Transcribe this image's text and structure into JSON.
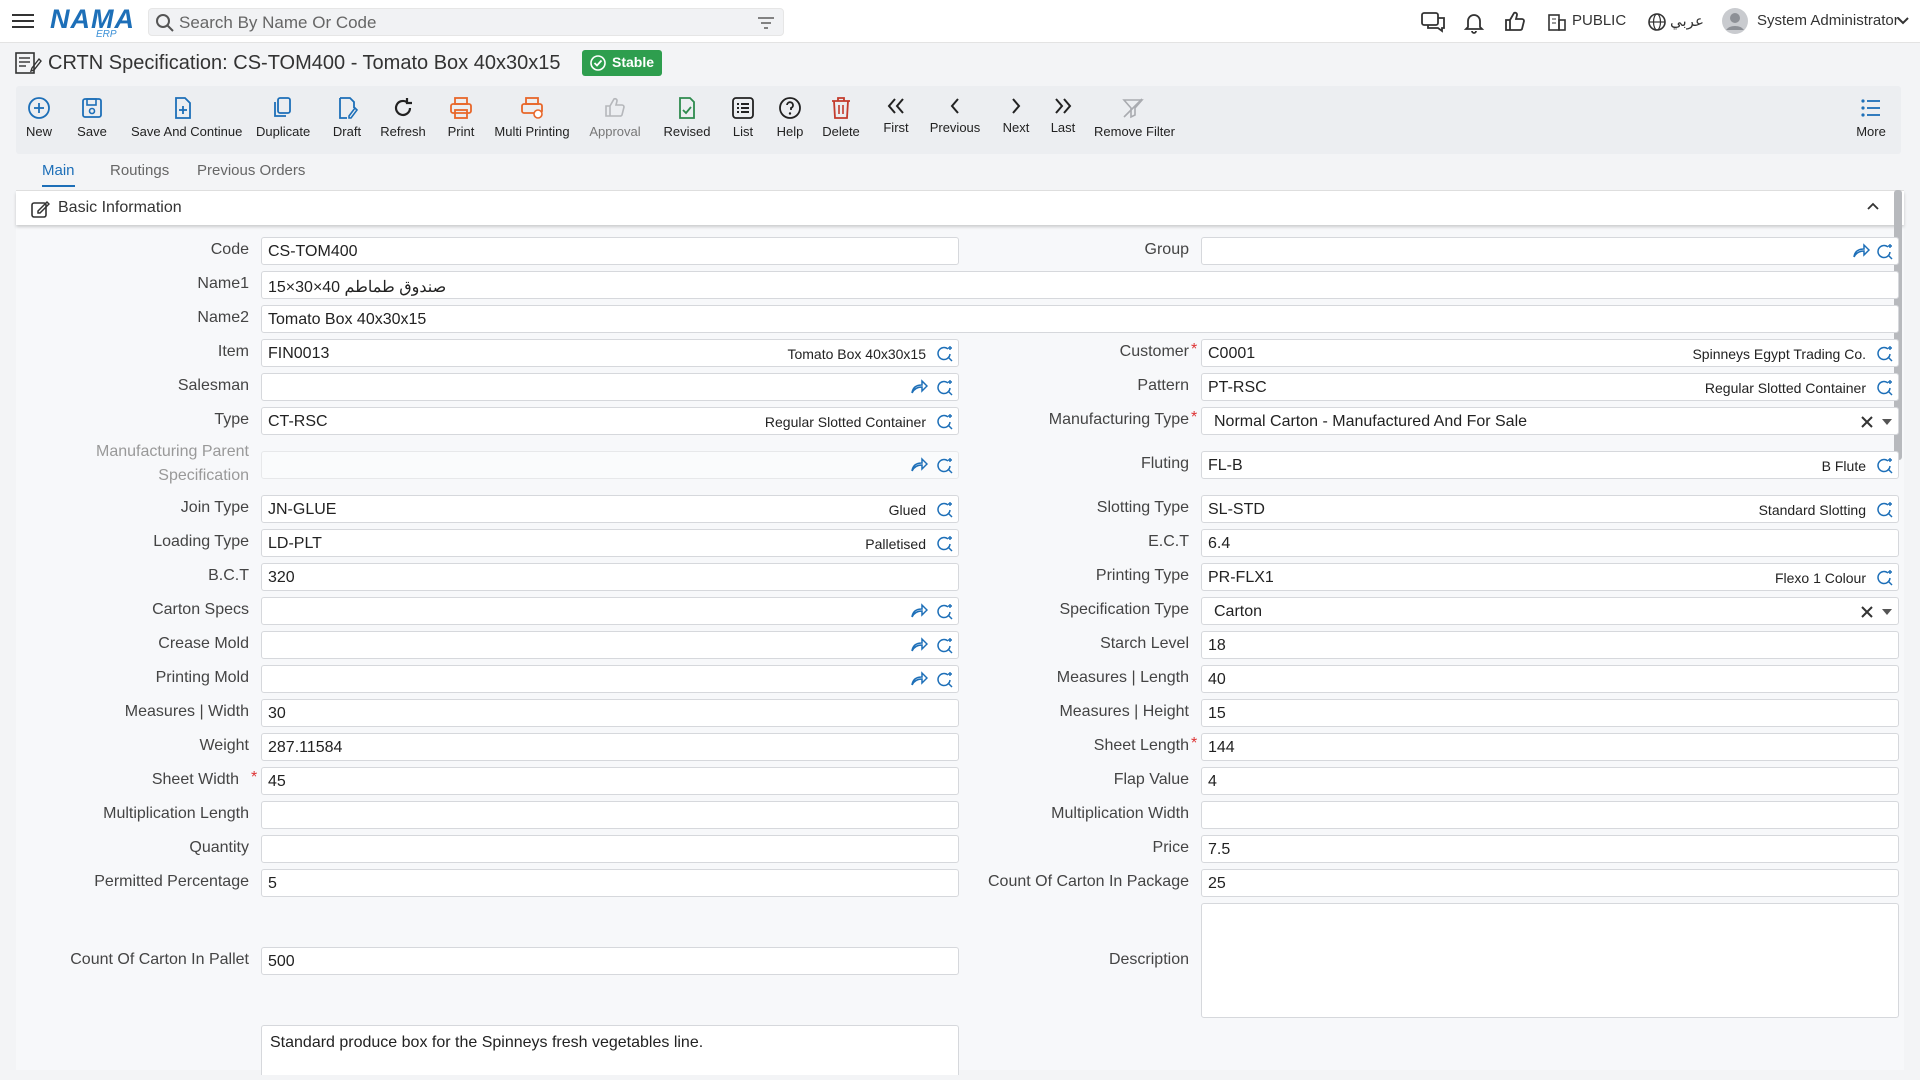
{
  "topbar": {
    "logo": "NAMA",
    "logo_sub": "ERP",
    "search_placeholder": "Search By Name Or Code",
    "company": "PUBLIC",
    "language": "عربي",
    "user": "System Administrator"
  },
  "page": {
    "title": "CRTN Specification: CS-TOM400 - Tomato Box 40x30x15",
    "status": "Stable",
    "status_color": "#2e9e4e"
  },
  "toolbar": {
    "new": "New",
    "save": "Save",
    "save_continue": "Save And Continue",
    "duplicate": "Duplicate",
    "draft": "Draft",
    "refresh": "Refresh",
    "print": "Print",
    "multi_printing": "Multi Printing",
    "approval": "Approval",
    "revised": "Revised",
    "list": "List",
    "help": "Help",
    "delete": "Delete",
    "first": "First",
    "previous": "Previous",
    "next": "Next",
    "last": "Last",
    "remove_filter": "Remove Filter",
    "more": "More"
  },
  "tabs": [
    "Main",
    "Routings",
    "Previous Orders"
  ],
  "section": {
    "title": "Basic Information"
  },
  "form": {
    "code": {
      "label": "Code",
      "value": "CS-TOM400"
    },
    "group": {
      "label": "Group",
      "value": ""
    },
    "name1": {
      "label": "Name1",
      "value": "صندوق طماطم 40×30×15"
    },
    "name2": {
      "label": "Name2",
      "value": "Tomato Box 40x30x15"
    },
    "item": {
      "label": "Item",
      "value": "FIN0013",
      "desc": "Tomato Box 40x30x15"
    },
    "customer": {
      "label": "Customer",
      "value": "C0001",
      "desc": "Spinneys Egypt Trading Co."
    },
    "salesman": {
      "label": "Salesman",
      "value": ""
    },
    "pattern": {
      "label": "Pattern",
      "value": "PT-RSC",
      "desc": "Regular Slotted Container"
    },
    "type": {
      "label": "Type",
      "value": "CT-RSC",
      "desc": "Regular Slotted Container"
    },
    "manufacturing_type": {
      "label": "Manufacturing Type",
      "value": "Normal Carton - Manufactured And For Sale"
    },
    "mfg_parent_spec": {
      "label": "Manufacturing Parent Specification",
      "value": ""
    },
    "fluting": {
      "label": "Fluting",
      "value": "FL-B",
      "desc": "B Flute"
    },
    "join_type": {
      "label": "Join Type",
      "value": "JN-GLUE",
      "desc": "Glued"
    },
    "slotting_type": {
      "label": "Slotting Type",
      "value": "SL-STD",
      "desc": "Standard Slotting"
    },
    "loading_type": {
      "label": "Loading Type",
      "value": "LD-PLT",
      "desc": "Palletised"
    },
    "ect": {
      "label": "E.C.T",
      "value": "6.4"
    },
    "bct": {
      "label": "B.C.T",
      "value": "320"
    },
    "printing_type": {
      "label": "Printing Type",
      "value": "PR-FLX1",
      "desc": "Flexo 1 Colour"
    },
    "carton_specs": {
      "label": "Carton Specs",
      "value": ""
    },
    "specification_type": {
      "label": "Specification Type",
      "value": "Carton"
    },
    "crease_mold": {
      "label": "Crease Mold",
      "value": ""
    },
    "starch_level": {
      "label": "Starch Level",
      "value": "18"
    },
    "printing_mold": {
      "label": "Printing Mold",
      "value": ""
    },
    "measures_length": {
      "label": "Measures | Length",
      "value": "40"
    },
    "measures_width": {
      "label": "Measures | Width",
      "value": "30"
    },
    "measures_height": {
      "label": "Measures | Height",
      "value": "15"
    },
    "weight": {
      "label": "Weight",
      "value": "287.11584"
    },
    "sheet_length": {
      "label": "Sheet Length",
      "value": "144"
    },
    "sheet_width": {
      "label": "Sheet Width",
      "value": "45"
    },
    "flap_value": {
      "label": "Flap Value",
      "value": "4"
    },
    "multiplication_length": {
      "label": "Multiplication Length",
      "value": ""
    },
    "multiplication_width": {
      "label": "Multiplication Width",
      "value": ""
    },
    "quantity": {
      "label": "Quantity",
      "value": ""
    },
    "price": {
      "label": "Price",
      "value": "7.5"
    },
    "permitted_percentage": {
      "label": "Permitted Percentage",
      "value": "5"
    },
    "count_in_package": {
      "label": "Count Of Carton In Package",
      "value": "25"
    },
    "count_in_pallet": {
      "label": "Count Of Carton In Pallet",
      "value": "500"
    },
    "description": {
      "label": "Description",
      "value": ""
    },
    "remarks": {
      "value": "Standard produce box for the Spinneys fresh vegetables line."
    }
  },
  "icons": {
    "lookup": "lookup-search-icon",
    "share": "share-arrow-icon",
    "clear": "clear-x-icon",
    "dropdown": "chevron-down-icon"
  },
  "colors": {
    "accent": "#1d6fb8",
    "required": "#d33333",
    "toolbar_blue": "#1d6fb8",
    "toolbar_orange": "#e8672a",
    "delete_red": "#c33b2c"
  }
}
